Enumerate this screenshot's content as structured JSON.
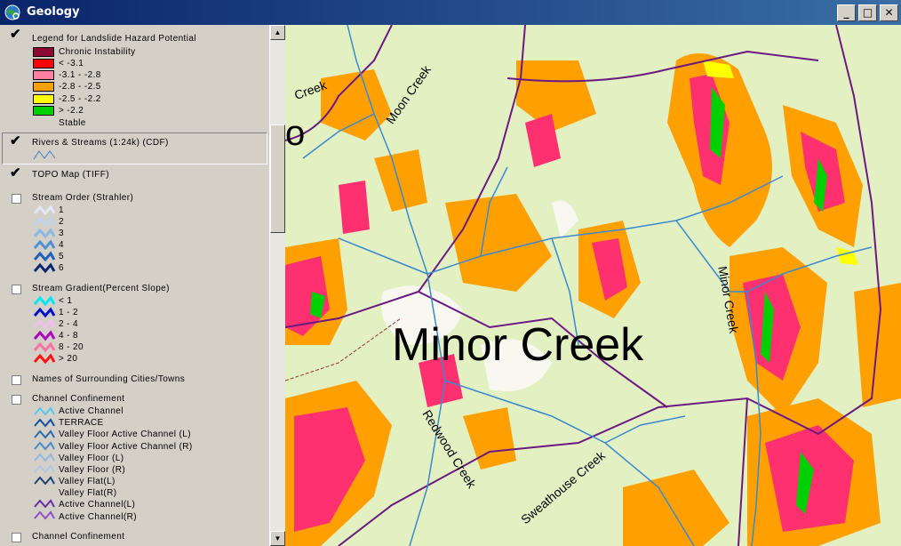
{
  "window": {
    "title": "Geology"
  },
  "legend": {
    "title": "Legend for Landslide Hazard Potential",
    "classes": [
      {
        "label": "Chronic Instability",
        "color": "#8b0a32"
      },
      {
        "label": "<  -3.1",
        "color": "#ff0000"
      },
      {
        "label": "-3.1 - -2.8",
        "color": "#ff7fa0"
      },
      {
        "label": "-2.8 - -2.5",
        "color": "#ffa000"
      },
      {
        "label": "-2.5 - -2.2",
        "color": "#ffff00"
      },
      {
        "label": "> -2.2",
        "color": "#00d000"
      },
      {
        "label": "Stable",
        "color": "#d4d0c8"
      }
    ]
  },
  "layers": {
    "rivers": "Rivers & Streams (1:24k) (CDF)",
    "topo": "TOPO Map (TIFF)",
    "stream_order": {
      "name": "Stream Order (Strahler)",
      "items": [
        "1",
        "2",
        "3",
        "4",
        "5",
        "6"
      ]
    },
    "gradient": {
      "name": "Stream Gradient(Percent Slope)",
      "items": [
        "< 1",
        "1 - 2",
        "2 - 4",
        "4 - 8",
        "8 - 20",
        "> 20"
      ]
    },
    "towns": "Names of Surrounding Cities/Towns",
    "confinement": {
      "name": "Channel Confinement",
      "items": [
        "Active Channel",
        "TERRACE",
        "Valley Floor Active Channel (L)",
        "Valley Floor Active Channel (R)",
        "Valley Floor (L)",
        "Valley Floor (R)",
        "Valley Flat(L)",
        "Valley Flat(R)",
        "Active Channel(L)",
        "Active Channel(R)"
      ]
    },
    "confinement2": "Channel Confinement"
  },
  "map": {
    "main_label": "Minor Creek",
    "labels": [
      "Moon Creek",
      "Minor Creek",
      "Redwood Creek",
      "Sweathouse Creek",
      "Creek",
      "o"
    ]
  }
}
